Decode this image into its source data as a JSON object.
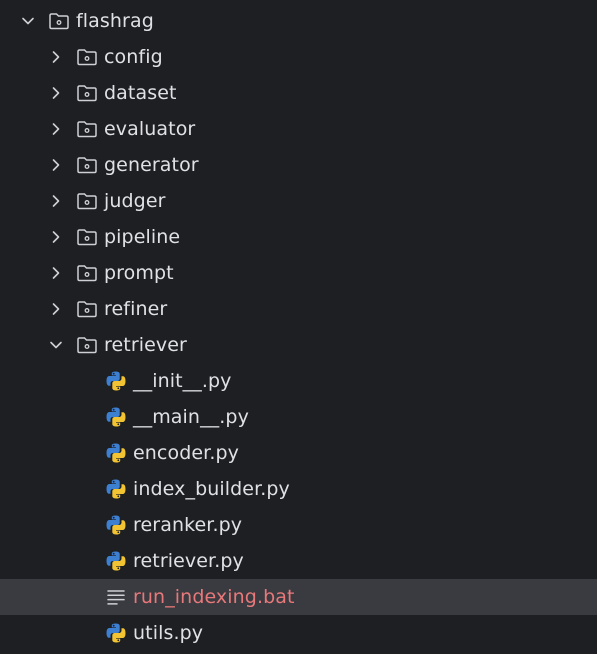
{
  "tree": {
    "root": {
      "label": "flashrag",
      "expanded": true
    },
    "folders": [
      {
        "label": "config",
        "expanded": false
      },
      {
        "label": "dataset",
        "expanded": false
      },
      {
        "label": "evaluator",
        "expanded": false
      },
      {
        "label": "generator",
        "expanded": false
      },
      {
        "label": "judger",
        "expanded": false
      },
      {
        "label": "pipeline",
        "expanded": false
      },
      {
        "label": "prompt",
        "expanded": false
      },
      {
        "label": "refiner",
        "expanded": false
      },
      {
        "label": "retriever",
        "expanded": true
      }
    ],
    "files": [
      {
        "label": "__init__.py",
        "icon": "python-file-icon"
      },
      {
        "label": "__main__.py",
        "icon": "python-file-icon"
      },
      {
        "label": "encoder.py",
        "icon": "python-file-icon"
      },
      {
        "label": "index_builder.py",
        "icon": "python-file-icon"
      },
      {
        "label": "reranker.py",
        "icon": "python-file-icon"
      },
      {
        "label": "retriever.py",
        "icon": "python-file-icon"
      },
      {
        "label": "run_indexing.bat",
        "icon": "text-file-icon",
        "selected": true
      },
      {
        "label": "utils.py",
        "icon": "python-file-icon"
      }
    ]
  },
  "colors": {
    "background": "#1e1f22",
    "selected_row": "#393b40",
    "text": "#dfe1e5",
    "bat_text": "#e8787a",
    "icon_stroke": "#ced0d6",
    "python_blue": "#3d7fd1",
    "python_yellow": "#f2c433"
  }
}
